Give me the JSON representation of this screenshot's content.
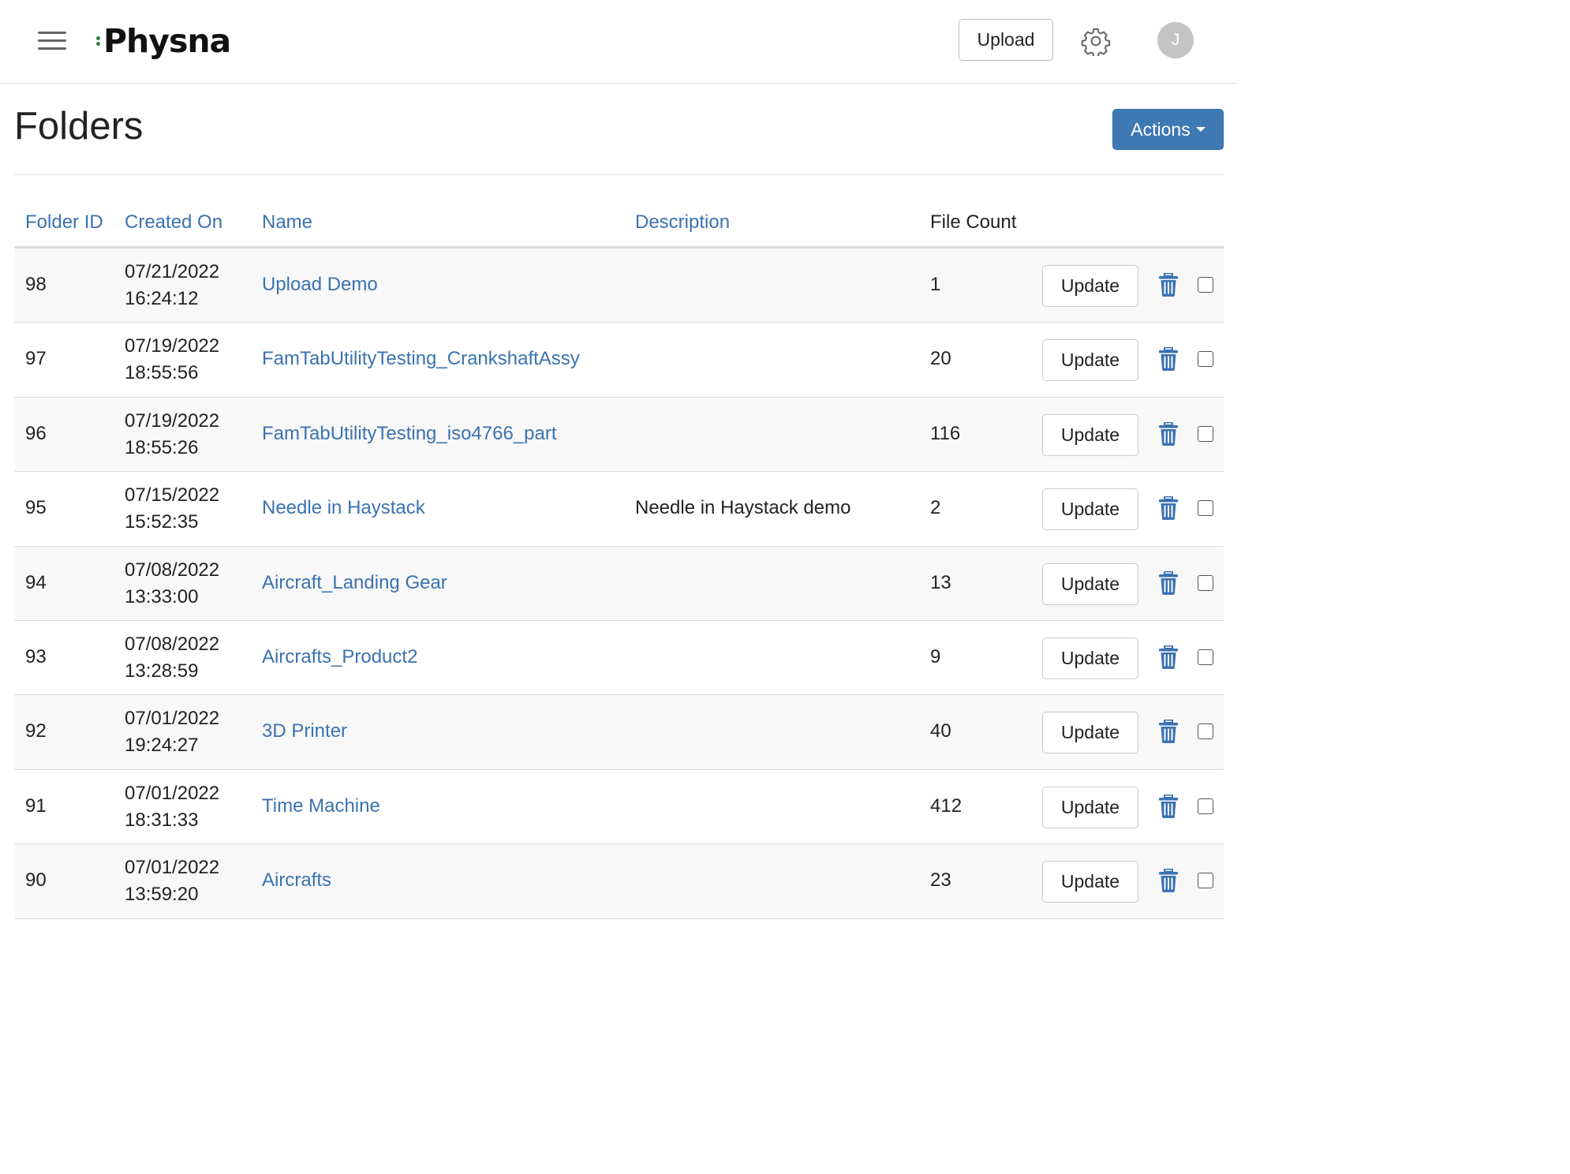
{
  "header": {
    "logo_text": "Physna",
    "upload_label": "Upload",
    "avatar_initial": "J"
  },
  "page": {
    "title": "Folders",
    "actions_label": "Actions"
  },
  "table": {
    "columns": {
      "folder_id": "Folder ID",
      "created_on": "Created On",
      "name": "Name",
      "description": "Description",
      "file_count": "File Count"
    },
    "update_label": "Update",
    "rows": [
      {
        "id": "98",
        "date": "07/21/2022",
        "time": "16:24:12",
        "name": "Upload Demo",
        "description": "",
        "count": "1"
      },
      {
        "id": "97",
        "date": "07/19/2022",
        "time": "18:55:56",
        "name": "FamTabUtilityTesting_CrankshaftAssy",
        "description": "",
        "count": "20"
      },
      {
        "id": "96",
        "date": "07/19/2022",
        "time": "18:55:26",
        "name": "FamTabUtilityTesting_iso4766_part",
        "description": "",
        "count": "116"
      },
      {
        "id": "95",
        "date": "07/15/2022",
        "time": "15:52:35",
        "name": "Needle in Haystack",
        "description": "Needle in Haystack demo",
        "count": "2"
      },
      {
        "id": "94",
        "date": "07/08/2022",
        "time": "13:33:00",
        "name": "Aircraft_Landing Gear",
        "description": "",
        "count": "13"
      },
      {
        "id": "93",
        "date": "07/08/2022",
        "time": "13:28:59",
        "name": "Aircrafts_Product2",
        "description": "",
        "count": "9"
      },
      {
        "id": "92",
        "date": "07/01/2022",
        "time": "19:24:27",
        "name": "3D Printer",
        "description": "",
        "count": "40"
      },
      {
        "id": "91",
        "date": "07/01/2022",
        "time": "18:31:33",
        "name": "Time Machine",
        "description": "",
        "count": "412"
      },
      {
        "id": "90",
        "date": "07/01/2022",
        "time": "13:59:20",
        "name": "Aircrafts",
        "description": "",
        "count": "23"
      }
    ]
  },
  "colors": {
    "link": "#3a72b0",
    "primary_button": "#3f79b4",
    "logo_accent": "#2e7d32",
    "trash_icon": "#3a72b0"
  },
  "icons": {
    "menu": "hamburger-menu-icon",
    "settings": "gear-icon",
    "delete": "trash-icon",
    "select": "checkbox"
  }
}
